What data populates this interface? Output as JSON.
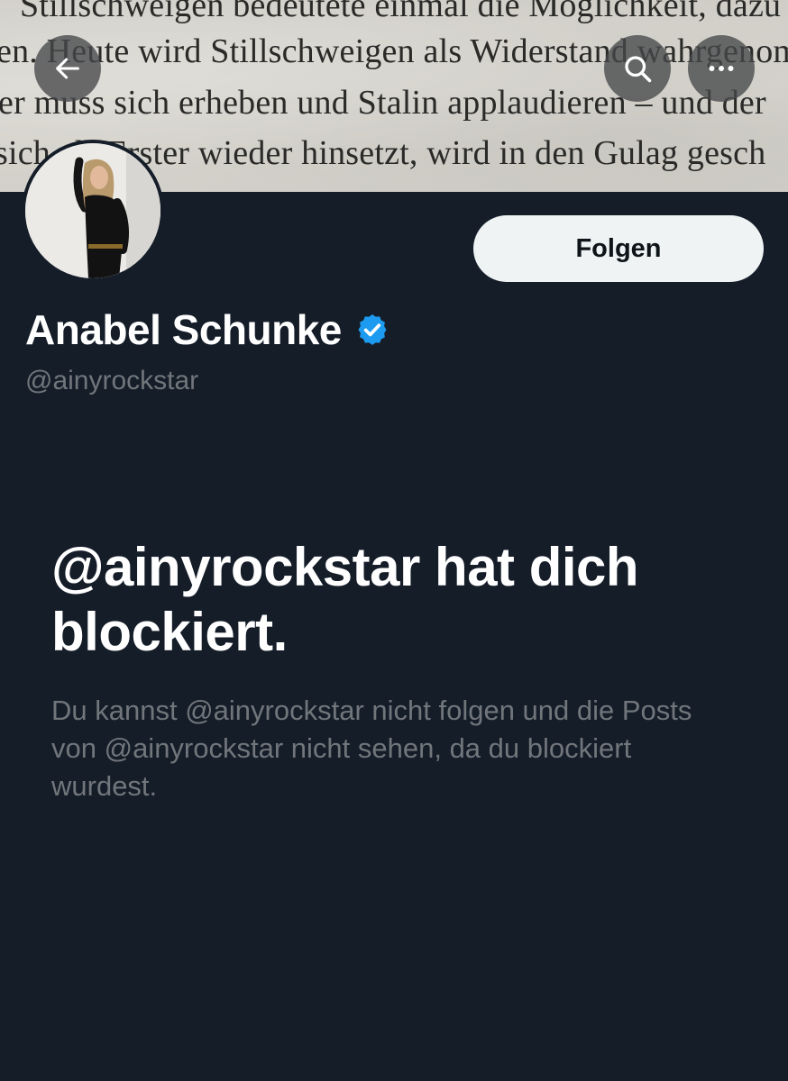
{
  "banner": {
    "text_lines": [
      "Stillschweigen bedeutete einmal die Möglichkeit, dazu",
      "en. Heute wird Stillschweigen als Widerstand wahrgenom",
      "er muss sich erheben und Stalin applaudieren – und der",
      "sich als Erster wieder hinsetzt, wird in den Gulag gesch"
    ]
  },
  "toolbar": {
    "back_icon": "arrow-left-icon",
    "search_icon": "search-icon",
    "more_icon": "more-horizontal-icon"
  },
  "profile": {
    "display_name": "Anabel Schunke",
    "handle": "@ainyrockstar",
    "verified": true,
    "verified_color": "#1d9bf0",
    "follow_label": "Folgen"
  },
  "blocked": {
    "title": "@ainyrockstar hat dich blockiert.",
    "description": "Du kannst @ainyrockstar nicht folgen und die Posts von @ainyrockstar nicht sehen, da du blockiert wurdest."
  },
  "colors": {
    "background": "#151d29",
    "primary_text": "#ffffff",
    "secondary_text": "#71767b",
    "button_bg": "#eff3f4",
    "button_text": "#0f1419"
  }
}
